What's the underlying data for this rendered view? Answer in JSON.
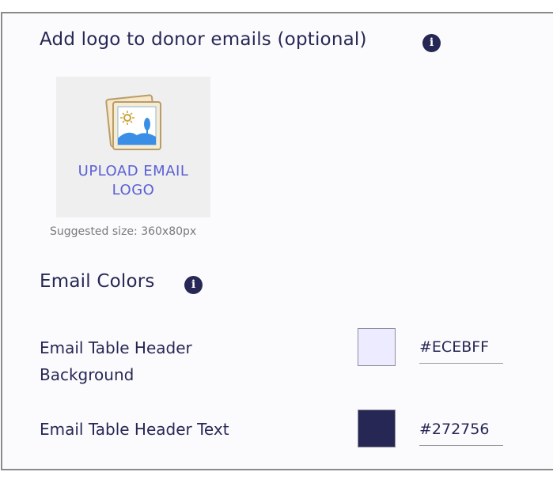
{
  "logo_section": {
    "title": "Add logo to donor emails (optional)",
    "info_icon": "info-icon",
    "upload_label": "UPLOAD EMAIL LOGO",
    "upload_icon": "image-upload-icon",
    "suggested_size": "Suggested size: 360x80px"
  },
  "colors_section": {
    "title": "Email Colors",
    "info_icon": "info-icon",
    "rows": [
      {
        "label": "Email Table Header Background",
        "value": "#ECEBFF",
        "swatch_color": "#ECEBFF"
      },
      {
        "label": "Email Table Header Text",
        "value": "#272756",
        "swatch_color": "#272756"
      }
    ]
  }
}
